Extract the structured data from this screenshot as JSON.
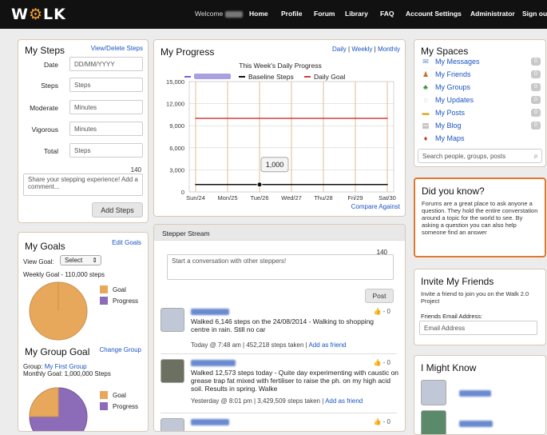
{
  "header": {
    "logo": "WALK",
    "welcome": "Welcome",
    "nav": [
      "Home",
      "Profile",
      "Forum",
      "Library",
      "FAQ",
      "Account Settings",
      "Administrator",
      "Sign out"
    ]
  },
  "steps": {
    "title": "My Steps",
    "link": "View/Delete Steps",
    "date_label": "Date",
    "date_placeholder": "DD/MM/YYYY",
    "steps_label": "Steps",
    "steps_placeholder": "Steps",
    "moderate_label": "Moderate",
    "moderate_placeholder": "Minutes",
    "vigorous_label": "Vigorous",
    "vigorous_placeholder": "Minutes",
    "total_label": "Total",
    "total_placeholder": "Steps",
    "counter": "140",
    "comment_placeholder": "Share your stepping experience! Add a comment...",
    "button": "Add Steps"
  },
  "goals": {
    "title": "My Goals",
    "link": "Edit Goals",
    "view_label": "View Goal:",
    "select_value": "Select",
    "weekly": "Weekly Goal - 110,000 steps",
    "legend_goal": "Goal",
    "legend_progress": "Progress",
    "goal_color": "#e8a85c",
    "progress_color": "#8c6cb8",
    "goal_fraction": 1.0
  },
  "group_goal": {
    "title": "My Group Goal",
    "link": "Change Group",
    "group_label": "Group:",
    "group_name": "My First Group",
    "monthly": "Monthly Goal: 1,000,000 Steps",
    "legend_goal": "Goal",
    "legend_progress": "Progress",
    "progress_fraction": 0.75
  },
  "progress": {
    "title": "My Progress",
    "daily": "Daily",
    "weekly": "Weekly",
    "monthly": "Monthly",
    "sep": "|",
    "compare": "Compare Against",
    "tooltip": "1,000"
  },
  "chart_data": {
    "type": "line",
    "title": "This Week's Daily Progress",
    "categories": [
      "Sun/24",
      "Mon/25",
      "Tue/26",
      "Wed/27",
      "Thu/28",
      "Fri/29",
      "Sat/30"
    ],
    "ylim": [
      0,
      15000
    ],
    "yticks": [
      "0",
      "3,000",
      "6,000",
      "9,000",
      "12,000",
      "15,000"
    ],
    "series": [
      {
        "name": "Baseline Steps",
        "color": "#111111",
        "values": [
          1000,
          1000,
          1000,
          1000,
          1000,
          1000,
          1000
        ]
      },
      {
        "name": "Daily Goal",
        "color": "#d04040",
        "values": [
          10000,
          10000,
          10000,
          10000,
          10000,
          10000,
          10000
        ]
      }
    ],
    "highlight_point": {
      "x": "Tue/26",
      "y": 1000
    }
  },
  "stream": {
    "title": "Stepper Stream",
    "counter": "140",
    "placeholder": "Start a conversation with other steppers!",
    "post_button": "Post",
    "posts": [
      {
        "text": "Walked 6,146 steps on the 24/08/2014 - Walking to shopping centre in rain. Still no car",
        "meta": "Today @ 7:48 am | 452,218 steps taken | ",
        "add": "Add as friend",
        "likes": "- 0"
      },
      {
        "text": "Walked 12,573 steps today - Quite day experimenting with caustic on grease trap fat mixed with fertiliser to raise the ph. on my high acid soil. Results in spring. Walke",
        "meta": "Yesterday @ 8:01 pm | 3,429,509 steps taken | ",
        "add": "Add as friend",
        "likes": "- 0"
      },
      {
        "likes": "- 0"
      }
    ]
  },
  "spaces": {
    "title": "My Spaces",
    "items": [
      {
        "label": "My Messages",
        "count": "0",
        "icon": "envelope-icon"
      },
      {
        "label": "My Friends",
        "count": "0",
        "icon": "person-icon"
      },
      {
        "label": "My Groups",
        "count": "0",
        "icon": "group-icon"
      },
      {
        "label": "My Updates",
        "count": "0",
        "icon": "speech-bubble-icon"
      },
      {
        "label": "My Posts",
        "count": "0",
        "icon": "folder-icon"
      },
      {
        "label": "My Blog",
        "count": "0",
        "icon": "document-icon"
      },
      {
        "label": "My Maps",
        "icon": "map-pin-icon"
      }
    ],
    "search_placeholder": "Search people, groups, posts"
  },
  "didyouknow": {
    "title": "Did you know?",
    "text": "Forums are a great place to ask anyone a question. They hold the entire converstation around a topic for the world to see. By asking a question you can also help someone find an answer"
  },
  "invite": {
    "title": "Invite My Friends",
    "text": "Invite a friend to join you on the Walk 2.0 Project",
    "email_label": "Friends Email Address:",
    "email_placeholder": "Email Address"
  },
  "might_know": {
    "title": "I Might Know"
  }
}
